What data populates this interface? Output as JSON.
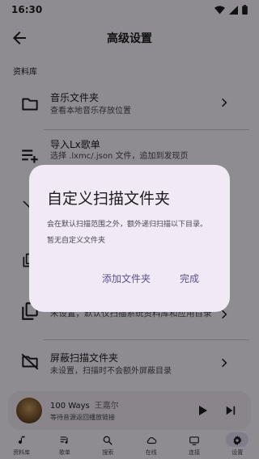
{
  "status_bar": {
    "time": "16:30",
    "icons": [
      "wifi-icon",
      "signal-icon",
      "battery-icon"
    ]
  },
  "top_bar": {
    "title": "高级设置",
    "back_icon": "arrow-back-icon"
  },
  "section": {
    "label": "资料库"
  },
  "settings_rows": [
    {
      "icon": "folder-icon",
      "title": "音乐文件夹",
      "subtitle": "查看本地音乐存放位置"
    },
    {
      "icon": "playlist-add-icon",
      "title": "导入Lx歌单",
      "subtitle": "选择 .lxmc/.json 文件，追加到发现页"
    },
    {
      "icon": "library-icon",
      "title": "",
      "subtitle": "未设置，默认仅扫描系统资料库和应用目录"
    },
    {
      "icon": "hide-folder-icon",
      "title": "屏蔽扫描文件夹",
      "subtitle": "未设置，扫描时不会额外屏蔽目录"
    }
  ],
  "player": {
    "title": "100 Ways",
    "artist": "王嘉尔",
    "status": "等待音源返回播放链接"
  },
  "nav": {
    "items": [
      {
        "label": "资料库",
        "icon": "music-note-icon"
      },
      {
        "label": "歌单",
        "icon": "playlist-icon"
      },
      {
        "label": "搜索",
        "icon": "search-icon"
      },
      {
        "label": "在线",
        "icon": "cloud-icon"
      },
      {
        "label": "连接",
        "icon": "link-icon"
      },
      {
        "label": "设置",
        "icon": "gear-icon"
      }
    ],
    "active_index": 5
  },
  "dialog": {
    "title": "自定义扫描文件夹",
    "description": "会在默认扫描范围之外，额外递归扫描以下目录。",
    "empty_text": "暂无自定义文件夹",
    "add_button": "添加文件夹",
    "done_button": "完成"
  },
  "colors": {
    "background": "#f7f2fa",
    "accent": "#5c4f8f",
    "dialog": "#f1eaf5",
    "scrim": "rgba(0,0,0,0.42)"
  }
}
